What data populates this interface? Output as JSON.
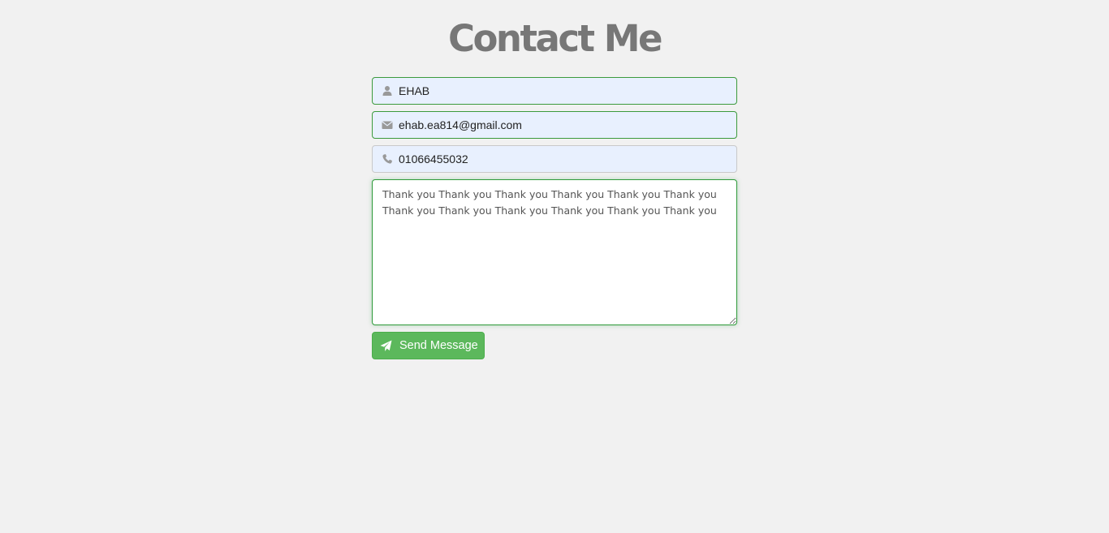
{
  "page": {
    "title": "Contact Me"
  },
  "form": {
    "name": {
      "icon": "user-icon",
      "value": "EHAB"
    },
    "email": {
      "icon": "envelope-icon",
      "value": "ehab.ea814@gmail.com"
    },
    "phone": {
      "icon": "phone-icon",
      "value": "01066455032"
    },
    "message": {
      "value": "Thank you Thank you Thank you Thank you Thank you Thank you Thank you Thank you Thank you Thank you Thank you Thank you"
    },
    "send_button": {
      "icon": "paper-plane-icon",
      "label": "Send Message"
    }
  },
  "colors": {
    "background": "#f1f1f1",
    "title": "#777777",
    "field_fill": "#e8f0fe",
    "valid_border": "#3c9a3c",
    "button": "#5cb85c"
  }
}
